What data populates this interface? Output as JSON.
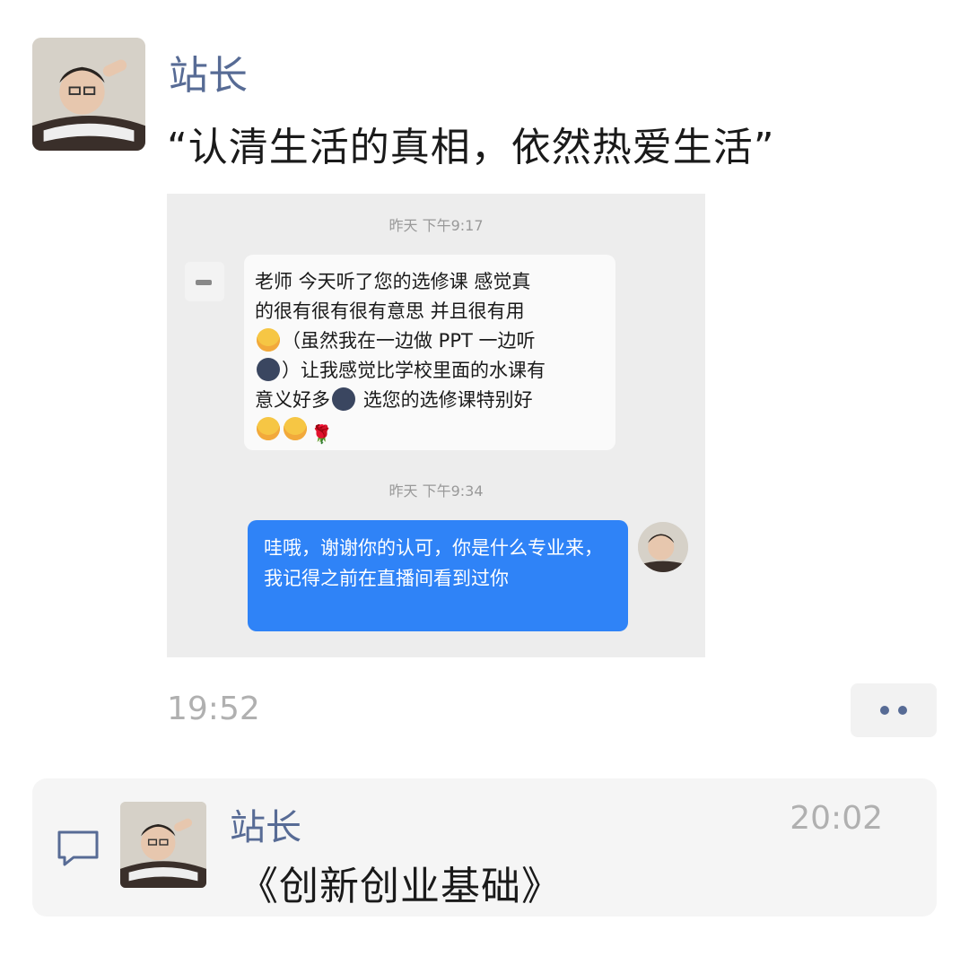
{
  "post": {
    "author": "站长",
    "text": "“认清生活的真相，依然热爱生活”",
    "time": "19:52"
  },
  "screenshot": {
    "time_1": "昨天 下午9:17",
    "incoming": {
      "line1": "老师 今天听了您的选修课 感觉真",
      "line2": "的很有很有很有意思 并且很有用",
      "line3_text": "（虽然我在一边做 PPT 一边听",
      "line4_text": "）让我感觉比学校里面的水课有",
      "line5_text_a": "意义好多",
      "line5_text_b": "选您的选修课特别好"
    },
    "time_2": "昨天 下午9:34",
    "outgoing": "哇哦，谢谢你的认可，你是什么专业来，我记得之前在直播间看到过你"
  },
  "comment": {
    "author": "站长",
    "time": "20:02",
    "text": "《创新创业基础》"
  },
  "colors": {
    "name_link": "#576b95",
    "bubble_out": "#2f83f7"
  }
}
